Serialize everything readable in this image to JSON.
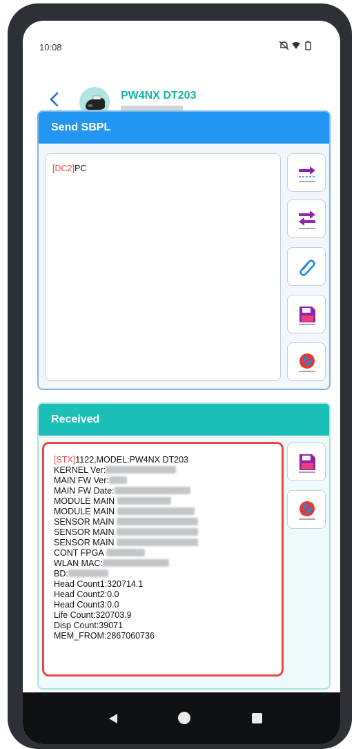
{
  "status_bar": {
    "time": "10:08"
  },
  "header": {
    "device_name": "PW4NX DT203",
    "device_subtitle": ""
  },
  "send_panel": {
    "title": "Send SBPL",
    "command_tag": "[DC2]",
    "command_text": "PC",
    "buttons": [
      "send-icon",
      "send-receive-icon",
      "attach-icon",
      "save-icon",
      "clear-icon"
    ]
  },
  "received_panel": {
    "title": "Received",
    "lines": [
      {
        "tag": "[STX]",
        "text": "1122,MODEL:PW4NX DT203"
      },
      {
        "text": "KERNEL Ver:"
      },
      {
        "text": "MAIN FW Ver:"
      },
      {
        "text": "MAIN FW Date:"
      },
      {
        "text": "MODULE MAIN"
      },
      {
        "text": "MODULE MAIN"
      },
      {
        "text": "SENSOR MAIN"
      },
      {
        "text": "SENSOR MAIN"
      },
      {
        "text": "SENSOR MAIN"
      },
      {
        "text": "CONT FPGA"
      },
      {
        "text": "WLAN MAC:"
      },
      {
        "text": "BD:"
      },
      {
        "text": "Head Count1:320714.1"
      },
      {
        "text": "Head Count2:0.0"
      },
      {
        "text": "Head Count3:0.0"
      },
      {
        "text": "Life Count:320703.9"
      },
      {
        "text": "Disp Count:39071"
      },
      {
        "text": "MEM_FROM:2867060736"
      }
    ],
    "buttons": [
      "save-icon",
      "clear-icon"
    ]
  },
  "colors": {
    "send_header": "#2196f3",
    "received_header": "#1bbfb8",
    "tag": "#f0474a",
    "highlight": "#ee4444"
  }
}
